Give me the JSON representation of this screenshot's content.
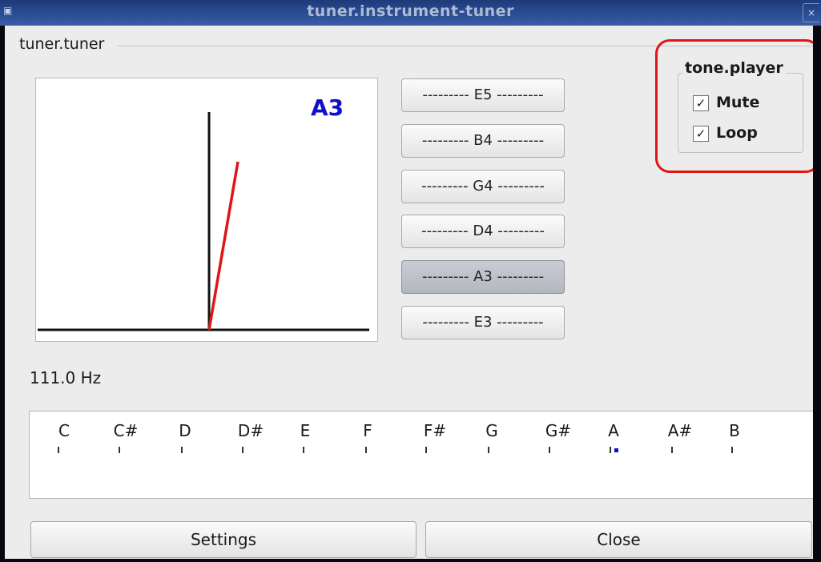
{
  "window": {
    "title": "tuner.instrument-tuner",
    "icon": "app-icon",
    "close_glyph": "×"
  },
  "tuner_group": {
    "title": "tuner.tuner"
  },
  "display": {
    "note": "A3",
    "needle_color": "#e01515",
    "note_color": "#1010c8"
  },
  "strings": [
    {
      "label": "--------- E5 ---------",
      "active": false
    },
    {
      "label": "--------- B4 ---------",
      "active": false
    },
    {
      "label": "--------- G4 ---------",
      "active": false
    },
    {
      "label": "--------- D4 ---------",
      "active": false
    },
    {
      "label": "--------- A3 ---------",
      "active": true
    },
    {
      "label": "--------- E3 ---------",
      "active": false
    }
  ],
  "tone_player": {
    "title": "tone.player",
    "mute": {
      "label": "Mute",
      "checked": true
    },
    "loop": {
      "label": "Loop",
      "checked": true
    },
    "check_glyph": "✓"
  },
  "frequency": "111.0 Hz",
  "note_scale": {
    "notes": [
      "C",
      "C#",
      "D",
      "D#",
      "E",
      "F",
      "F#",
      "G",
      "G#",
      "A",
      "A#",
      "B"
    ],
    "active_note": "A"
  },
  "buttons": {
    "settings": "Settings",
    "close": "Close"
  }
}
